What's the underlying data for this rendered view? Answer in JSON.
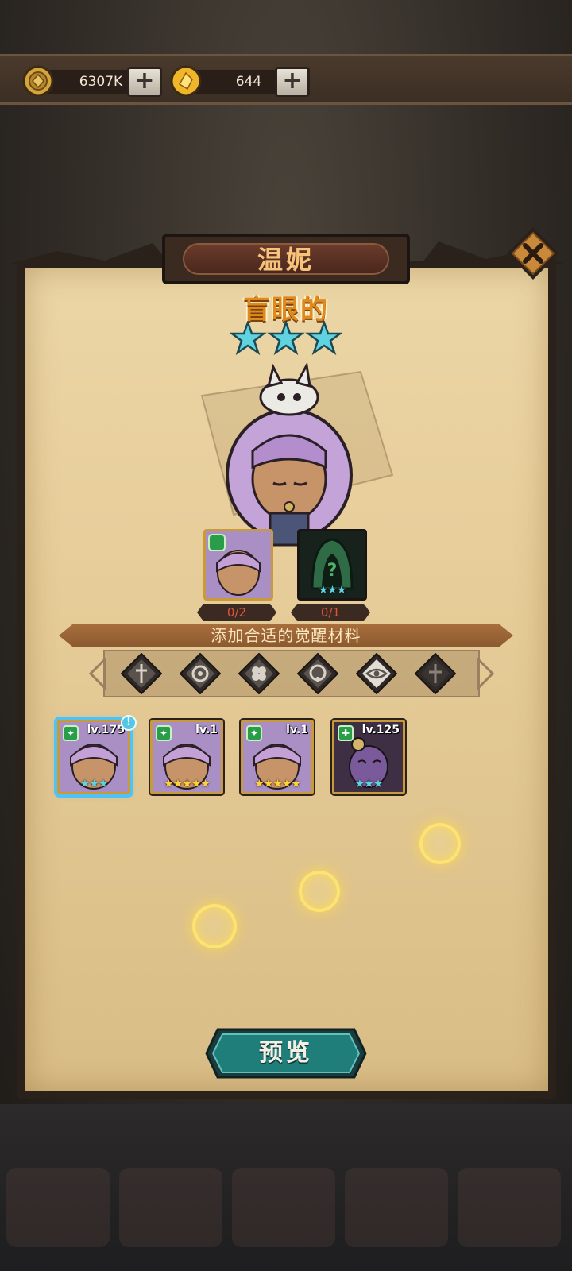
{
  "resources": {
    "gold": {
      "icon": "gold-coin-icon",
      "value": "6307K"
    },
    "gems": {
      "icon": "gold-crystal-icon",
      "value": "644"
    }
  },
  "panel": {
    "hero_name": "温妮",
    "hero_trait": "盲眼的",
    "hero_star_count": 3,
    "materials": [
      {
        "count": "0/2",
        "type": "same-hero"
      },
      {
        "count": "0/1",
        "type": "unknown-hero",
        "stars": "★★★"
      }
    ],
    "banner": "添加合适的觉醒材料",
    "filters": [
      "dagger-icon",
      "gear-icon",
      "clover-icon",
      "skull-icon",
      "eye-icon",
      "cross-icon"
    ],
    "cards": [
      {
        "level": "lv.175",
        "stars": "★★★",
        "faction": "green",
        "selected": true,
        "alert": "!"
      },
      {
        "level": "lv.1",
        "stars": "★★★★★",
        "faction": "green",
        "selected": false
      },
      {
        "level": "lv.1",
        "stars": "★★★★★",
        "faction": "green",
        "selected": false
      },
      {
        "level": "lv.125",
        "stars": "★★★",
        "faction": "green-plus",
        "selected": false
      }
    ],
    "preview_label": "预览"
  },
  "colors": {
    "parchment": "#e6cc98",
    "title_text": "#f7c27a",
    "trait_text": "#e08a1e",
    "count_text": "#e3533a",
    "preview_button": "#1f7d7a",
    "selected_outline": "#4fc3f7"
  }
}
